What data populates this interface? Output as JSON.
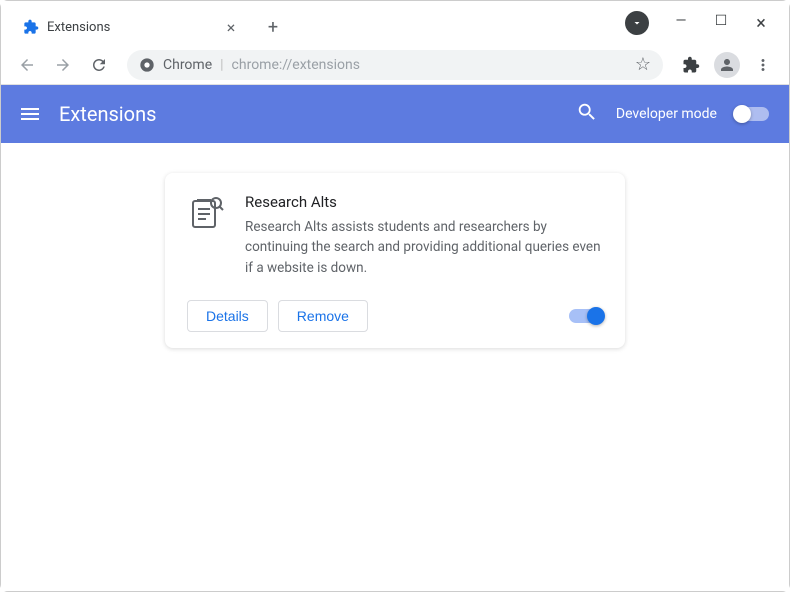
{
  "window": {
    "tab_title": "Extensions"
  },
  "omnibox": {
    "label": "Chrome",
    "path": "chrome://extensions"
  },
  "header": {
    "title": "Extensions",
    "dev_mode_label": "Developer mode",
    "dev_mode_on": false
  },
  "extension": {
    "name": "Research Alts",
    "description": "Research Alts assists students and researchers by continuing the search and providing additional queries even if a website is down.",
    "details_label": "Details",
    "remove_label": "Remove",
    "enabled": true
  }
}
